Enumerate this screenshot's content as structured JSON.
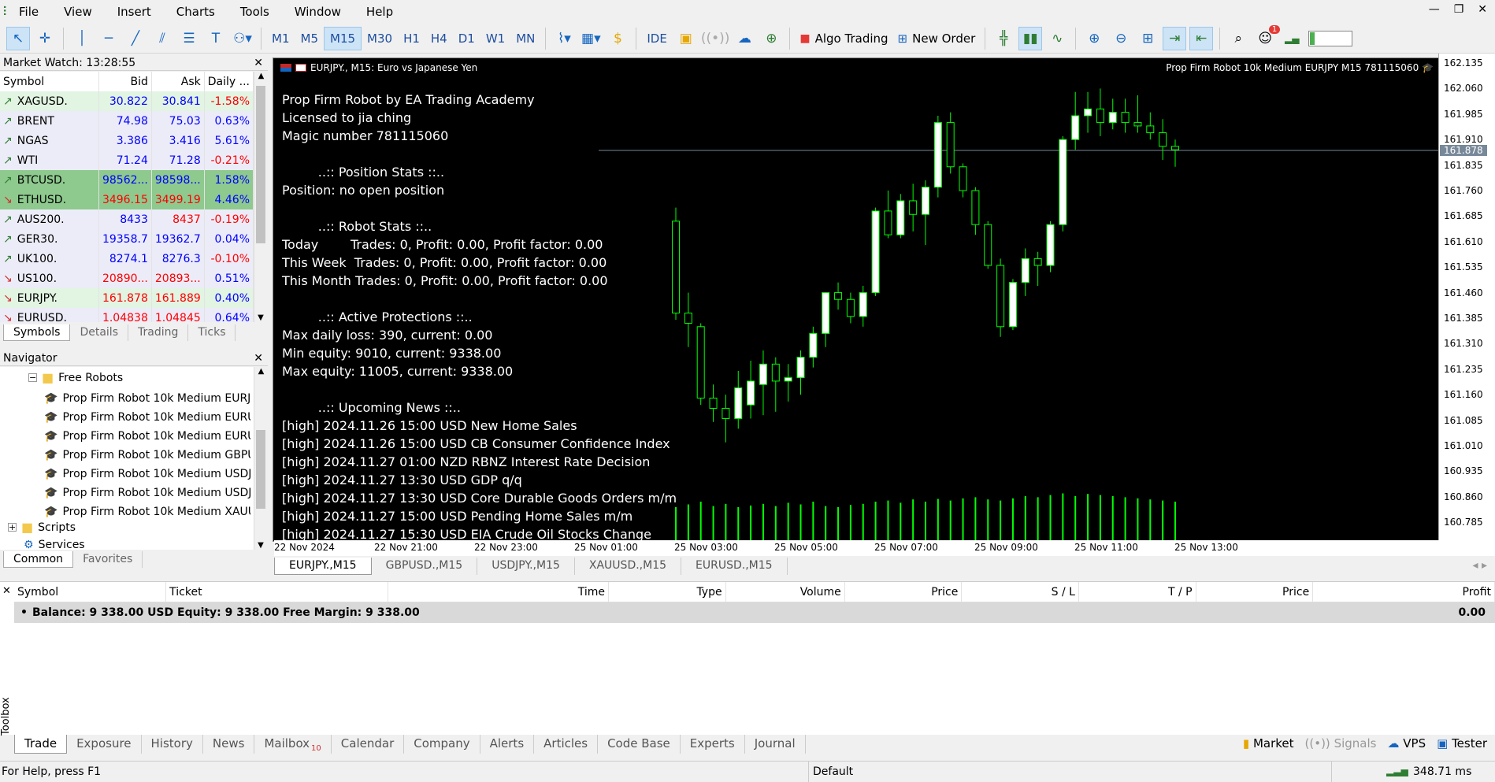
{
  "menu": [
    "File",
    "View",
    "Insert",
    "Charts",
    "Tools",
    "Window",
    "Help"
  ],
  "timeframes": [
    "M1",
    "M5",
    "M15",
    "M30",
    "H1",
    "H4",
    "D1",
    "W1",
    "MN"
  ],
  "selected_timeframe": "M15",
  "toolbar": {
    "ide": "IDE",
    "algo": "Algo Trading",
    "new_order": "New Order",
    "notify_count": "1"
  },
  "market_watch": {
    "title": "Market Watch: 13:28:55",
    "headers": [
      "Symbol",
      "Bid",
      "Ask",
      "Daily ..."
    ],
    "rows": [
      {
        "symbol": "XAGUSD.",
        "bid": "30.822",
        "ask": "30.841",
        "daily": "-1.58%",
        "dir": "up",
        "bg": "#e2f4e2",
        "bidc": "#0000ff",
        "askc": "#0000ff",
        "dc": "#ff0000"
      },
      {
        "symbol": "BRENT",
        "bid": "74.98",
        "ask": "75.03",
        "daily": "0.63%",
        "dir": "up",
        "bg": "#ececf8",
        "bidc": "#0000ff",
        "askc": "#0000ff",
        "dc": "#0000ff"
      },
      {
        "symbol": "NGAS",
        "bid": "3.386",
        "ask": "3.416",
        "daily": "5.61%",
        "dir": "up",
        "bg": "#ececf8",
        "bidc": "#0000ff",
        "askc": "#0000ff",
        "dc": "#0000ff"
      },
      {
        "symbol": "WTI",
        "bid": "71.24",
        "ask": "71.28",
        "daily": "-0.21%",
        "dir": "up",
        "bg": "#ececf8",
        "bidc": "#0000ff",
        "askc": "#0000ff",
        "dc": "#ff0000"
      },
      {
        "symbol": "BTCUSD.",
        "bid": "98562...",
        "ask": "98598...",
        "daily": "1.58%",
        "dir": "up",
        "bg": "#8ec98e",
        "bidc": "#0000ff",
        "askc": "#0000ff",
        "dc": "#0000ff"
      },
      {
        "symbol": "ETHUSD.",
        "bid": "3496.15",
        "ask": "3499.19",
        "daily": "4.46%",
        "dir": "down",
        "bg": "#8ec98e",
        "bidc": "#ff0000",
        "askc": "#ff0000",
        "dc": "#0000ff"
      },
      {
        "symbol": "AUS200.",
        "bid": "8433",
        "ask": "8437",
        "daily": "-0.19%",
        "dir": "up",
        "bg": "#ececf8",
        "bidc": "#0000ff",
        "askc": "#ff0000",
        "dc": "#ff0000"
      },
      {
        "symbol": "GER30.",
        "bid": "19358.7",
        "ask": "19362.7",
        "daily": "0.04%",
        "dir": "up",
        "bg": "#ececf8",
        "bidc": "#0000ff",
        "askc": "#0000ff",
        "dc": "#0000ff"
      },
      {
        "symbol": "UK100.",
        "bid": "8274.1",
        "ask": "8276.3",
        "daily": "-0.10%",
        "dir": "up",
        "bg": "#ececf8",
        "bidc": "#0000ff",
        "askc": "#0000ff",
        "dc": "#ff0000"
      },
      {
        "symbol": "US100.",
        "bid": "20890...",
        "ask": "20893...",
        "daily": "0.51%",
        "dir": "down",
        "bg": "#ececf8",
        "bidc": "#ff0000",
        "askc": "#ff0000",
        "dc": "#0000ff"
      },
      {
        "symbol": "EURJPY.",
        "bid": "161.878",
        "ask": "161.889",
        "daily": "0.40%",
        "dir": "down",
        "bg": "#e2f4e2",
        "bidc": "#ff0000",
        "askc": "#ff0000",
        "dc": "#0000ff"
      },
      {
        "symbol": "EURUSD.",
        "bid": "1.04838",
        "ask": "1.04845",
        "daily": "0.64%",
        "dir": "down",
        "bg": "#ececf8",
        "bidc": "#ff0000",
        "askc": "#ff0000",
        "dc": "#0000ff"
      }
    ],
    "tabs": [
      "Symbols",
      "Details",
      "Trading",
      "Ticks"
    ]
  },
  "navigator": {
    "title": "Navigator",
    "folder": "Free Robots",
    "items": [
      "Prop Firm Robot 10k Medium EURJ",
      "Prop Firm Robot 10k Medium EURU",
      "Prop Firm Robot 10k Medium EURU",
      "Prop Firm Robot 10k Medium GBPU",
      "Prop Firm Robot 10k Medium USDJ",
      "Prop Firm Robot 10k Medium USDJ",
      "Prop Firm Robot 10k Medium XAUU"
    ],
    "scripts": "Scripts",
    "services": "Services",
    "tabs": [
      "Common",
      "Favorites"
    ]
  },
  "chart": {
    "title": "EURJPY., M15:  Euro vs Japanese Yen",
    "ea_label": "Prop Firm Robot 10k Medium EURJPY M15 781115060",
    "info_lines": [
      "Prop Firm Robot by EA Trading Academy",
      "Licensed to jia ching",
      "Magic number 781115060",
      "",
      "         ..:: Position Stats ::..",
      "Position: no open position",
      "",
      "         ..:: Robot Stats ::..",
      "Today        Trades: 0, Profit: 0.00, Profit factor: 0.00",
      "This Week  Trades: 0, Profit: 0.00, Profit factor: 0.00",
      "This Month Trades: 0, Profit: 0.00, Profit factor: 0.00",
      "",
      "         ..:: Active Protections ::..",
      "Max daily loss: 390, current: 0.00",
      "Min equity: 9010, current: 9338.00",
      "Max equity: 11005, current: 9338.00",
      "",
      "         ..:: Upcoming News ::..",
      "[high] 2024.11.26 15:00 USD New Home Sales",
      "[high] 2024.11.26 15:00 USD CB Consumer Confidence Index",
      "[high] 2024.11.27 01:00 NZD RBNZ Interest Rate Decision",
      "[high] 2024.11.27 13:30 USD GDP q/q",
      "[high] 2024.11.27 13:30 USD Core Durable Goods Orders m/m",
      "[high] 2024.11.27 15:00 USD Pending Home Sales m/m",
      "[high] 2024.11.27 15:30 USD EIA Crude Oil Stocks Change"
    ],
    "price_labels": [
      "162.135",
      "162.060",
      "161.985",
      "161.910",
      "161.835",
      "161.760",
      "161.685",
      "161.610",
      "161.535",
      "161.460",
      "161.385",
      "161.310",
      "161.235",
      "161.160",
      "161.085",
      "161.010",
      "160.935",
      "160.860",
      "160.785"
    ],
    "current_price": "161.878",
    "time_labels": [
      "22 Nov 2024",
      "22 Nov 21:00",
      "22 Nov 23:00",
      "25 Nov 01:00",
      "25 Nov 03:00",
      "25 Nov 05:00",
      "25 Nov 07:00",
      "25 Nov 09:00",
      "25 Nov 11:00",
      "25 Nov 13:00"
    ],
    "tabs": [
      "EURJPY.,M15",
      "GBPUSD.,M15",
      "USDJPY.,M15",
      "XAUUSD.,M15",
      "EURUSD.,M15"
    ]
  },
  "chart_data": {
    "type": "candlestick",
    "ylim": [
      160.74,
      162.16
    ],
    "candles": [
      [
        161.67,
        161.71,
        161.38,
        161.4
      ],
      [
        161.4,
        161.46,
        161.3,
        161.37
      ],
      [
        161.36,
        161.37,
        161.13,
        161.15
      ],
      [
        161.15,
        161.19,
        161.08,
        161.12
      ],
      [
        161.12,
        161.16,
        161.02,
        161.09
      ],
      [
        161.09,
        161.23,
        161.06,
        161.18
      ],
      [
        161.13,
        161.26,
        161.09,
        161.2
      ],
      [
        161.19,
        161.29,
        161.1,
        161.25
      ],
      [
        161.25,
        161.27,
        161.11,
        161.2
      ],
      [
        161.2,
        161.25,
        161.14,
        161.21
      ],
      [
        161.21,
        161.29,
        161.16,
        161.27
      ],
      [
        161.27,
        161.36,
        161.24,
        161.34
      ],
      [
        161.34,
        161.42,
        161.3,
        161.46
      ],
      [
        161.46,
        161.49,
        161.41,
        161.44
      ],
      [
        161.44,
        161.46,
        161.37,
        161.39
      ],
      [
        161.39,
        161.48,
        161.36,
        161.46
      ],
      [
        161.46,
        161.71,
        161.45,
        161.7
      ],
      [
        161.7,
        161.76,
        161.62,
        161.63
      ],
      [
        161.63,
        161.75,
        161.62,
        161.73
      ],
      [
        161.73,
        161.78,
        161.64,
        161.69
      ],
      [
        161.69,
        161.79,
        161.6,
        161.77
      ],
      [
        161.77,
        161.98,
        161.74,
        161.96
      ],
      [
        161.96,
        161.99,
        161.81,
        161.83
      ],
      [
        161.83,
        161.84,
        161.74,
        161.76
      ],
      [
        161.76,
        161.77,
        161.63,
        161.66
      ],
      [
        161.66,
        161.67,
        161.53,
        161.54
      ],
      [
        161.54,
        161.56,
        161.33,
        161.36
      ],
      [
        161.36,
        161.5,
        161.35,
        161.49
      ],
      [
        161.49,
        161.59,
        161.45,
        161.56
      ],
      [
        161.56,
        161.58,
        161.48,
        161.54
      ],
      [
        161.54,
        161.67,
        161.52,
        161.66
      ],
      [
        161.66,
        161.92,
        161.64,
        161.91
      ],
      [
        161.91,
        162.05,
        161.88,
        161.98
      ],
      [
        161.98,
        162.05,
        161.93,
        162.0
      ],
      [
        162.0,
        162.06,
        161.92,
        161.96
      ],
      [
        161.96,
        162.03,
        161.94,
        161.99
      ],
      [
        161.99,
        162.03,
        161.93,
        161.96
      ],
      [
        161.96,
        162.04,
        161.93,
        161.95
      ],
      [
        161.95,
        161.99,
        161.91,
        161.93
      ],
      [
        161.93,
        161.97,
        161.85,
        161.89
      ],
      [
        161.89,
        161.91,
        161.83,
        161.88
      ]
    ],
    "volumes": [
      0.6,
      0.65,
      0.7,
      0.62,
      0.66,
      0.6,
      0.63,
      0.66,
      0.62,
      0.68,
      0.65,
      0.7,
      0.62,
      0.6,
      0.64,
      0.66,
      0.7,
      0.72,
      0.68,
      0.74,
      0.7,
      0.75,
      0.72,
      0.76,
      0.78,
      0.74,
      0.72,
      0.76,
      0.8,
      0.78,
      0.82,
      0.85,
      0.8,
      0.84,
      0.82,
      0.8,
      0.78,
      0.76,
      0.74,
      0.72,
      0.7
    ]
  },
  "toolbox": {
    "headers": [
      "Symbol",
      "Ticket",
      "Time",
      "Type",
      "Volume",
      "Price",
      "S / L",
      "T / P",
      "Price",
      "Profit"
    ],
    "balance": "Balance: 9 338.00 USD  Equity: 9 338.00  Free Margin: 9 338.00",
    "profit": "0.00",
    "side_label": "Toolbox",
    "tabs": [
      "Trade",
      "Exposure",
      "History",
      "News",
      "Mailbox",
      "Calendar",
      "Company",
      "Alerts",
      "Articles",
      "Code Base",
      "Experts",
      "Journal"
    ],
    "mailbox_count": "10",
    "right_items": [
      "Market",
      "Signals",
      "VPS",
      "Tester"
    ]
  },
  "status": {
    "help": "For Help, press F1",
    "profile": "Default",
    "ping": "348.71 ms"
  },
  "colors": {
    "candle_up": "#ffffff",
    "candle_border": "#00ff00",
    "volume": "#00ff00",
    "bid_line": "#778899"
  }
}
